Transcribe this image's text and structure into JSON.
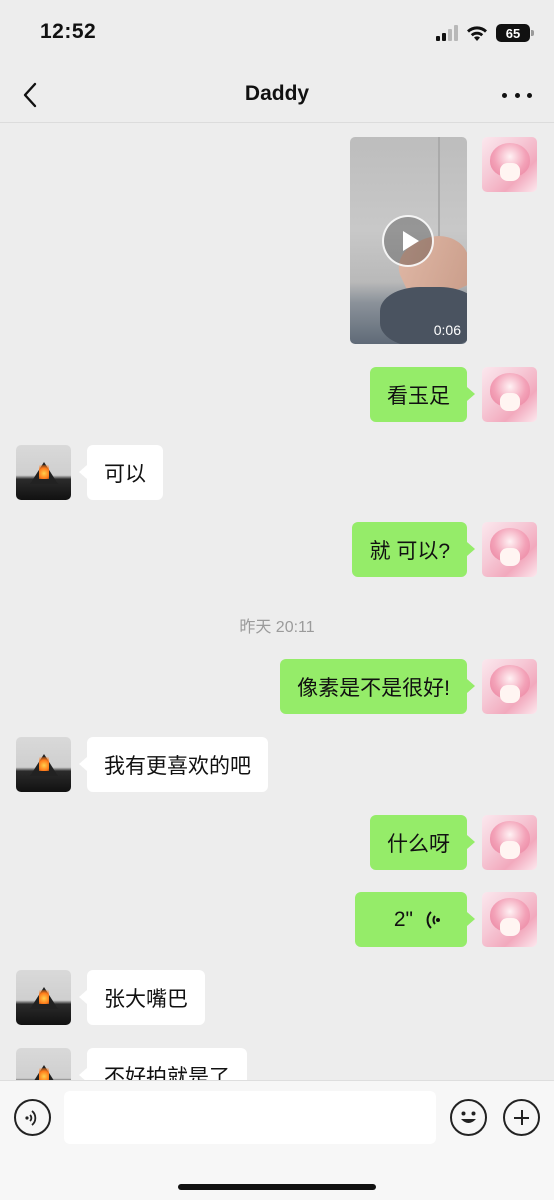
{
  "status_bar": {
    "time": "12:52",
    "battery": "65"
  },
  "nav": {
    "title": "Daddy"
  },
  "messages": [
    {
      "type": "video",
      "from": "me",
      "duration": "0:06"
    },
    {
      "type": "text",
      "from": "me",
      "text": "看玉足"
    },
    {
      "type": "text",
      "from": "other",
      "text": "可以"
    },
    {
      "type": "text",
      "from": "me",
      "text": "就 可以?"
    },
    {
      "type": "time",
      "text": "昨天 20:11"
    },
    {
      "type": "text",
      "from": "me",
      "text": "像素是不是很好!"
    },
    {
      "type": "text",
      "from": "other",
      "text": "我有更喜欢的吧"
    },
    {
      "type": "text",
      "from": "me",
      "text": "什么呀"
    },
    {
      "type": "voice",
      "from": "me",
      "duration": "2\""
    },
    {
      "type": "text",
      "from": "other",
      "text": "张大嘴巴"
    },
    {
      "type": "text",
      "from": "other",
      "text": "不好拍就是了"
    }
  ],
  "input_bar": {
    "placeholder": ""
  },
  "icons": {
    "back": "chevron-left-icon",
    "more": "more-dots-icon",
    "voice_toggle": "voice-input-icon",
    "emoji": "emoji-icon",
    "plus": "plus-icon"
  },
  "colors": {
    "my_bubble": "#95ec69",
    "their_bubble": "#ffffff",
    "background": "#ededed"
  }
}
